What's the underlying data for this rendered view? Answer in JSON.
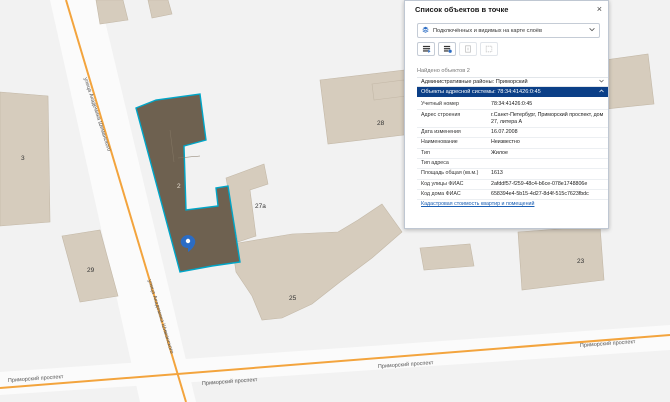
{
  "map": {
    "streets": {
      "academic_street_upper": "улица Академика Шиманского",
      "academic_street_lower": "улица Академика Шиманского",
      "primorsky_left": "Приморский проспект",
      "primorsky_center": "Приморский проспект",
      "primorsky_right": "Приморский проспект"
    },
    "houses": [
      "3",
      "29",
      "2",
      "27а",
      "28",
      "25",
      "23"
    ],
    "colors": {
      "building": "#d6ccbd",
      "selected_building": "#6e6150",
      "selection_outline": "#00a6c8",
      "street": "#f3a43d",
      "marker": "#2b6cc4"
    },
    "marker_icon": "map-pin-icon"
  },
  "panel": {
    "title": "Список объектов в точке",
    "close_label": "×",
    "layer_select": {
      "value": "Подключённых и видимых на карте слоёв",
      "icon": "layers-icon"
    },
    "toolbar": [
      "export-list-icon",
      "export-selected-icon",
      "report-icon",
      "frame-icon"
    ],
    "found_label": "Найдено объектов 2",
    "groups": [
      {
        "label": "Административные районы: Приморский",
        "expanded": false
      },
      {
        "label": "Объекты адресной системы: 78:34:41426:0:45",
        "expanded": true
      }
    ],
    "attributes": [
      {
        "key": "Учетный номер",
        "value": "78:34:41426:0:45"
      },
      {
        "key": "Адрес строения",
        "value": "г.Санкт-Петербург, Приморский проспект, дом 27, литера А"
      },
      {
        "key": "Дата изменения",
        "value": "16.07.2008"
      },
      {
        "key": "Наименование",
        "value": "Неизвестно"
      },
      {
        "key": "Тип",
        "value": "Жилое"
      },
      {
        "key": "Тип адреса",
        "value": ""
      },
      {
        "key": "Площадь общая (кв.м.)",
        "value": "1613"
      },
      {
        "key": "Код улицы ФИАС",
        "value": "2afddf57-f259-48c4-b6ce-078e1748806e"
      },
      {
        "key": "Код дома ФИАС",
        "value": "658394e4-5b15-4d27-8d4f-515c7623fbdc"
      }
    ],
    "link_label": "Кадастровая стоимость квартир и помещений"
  }
}
